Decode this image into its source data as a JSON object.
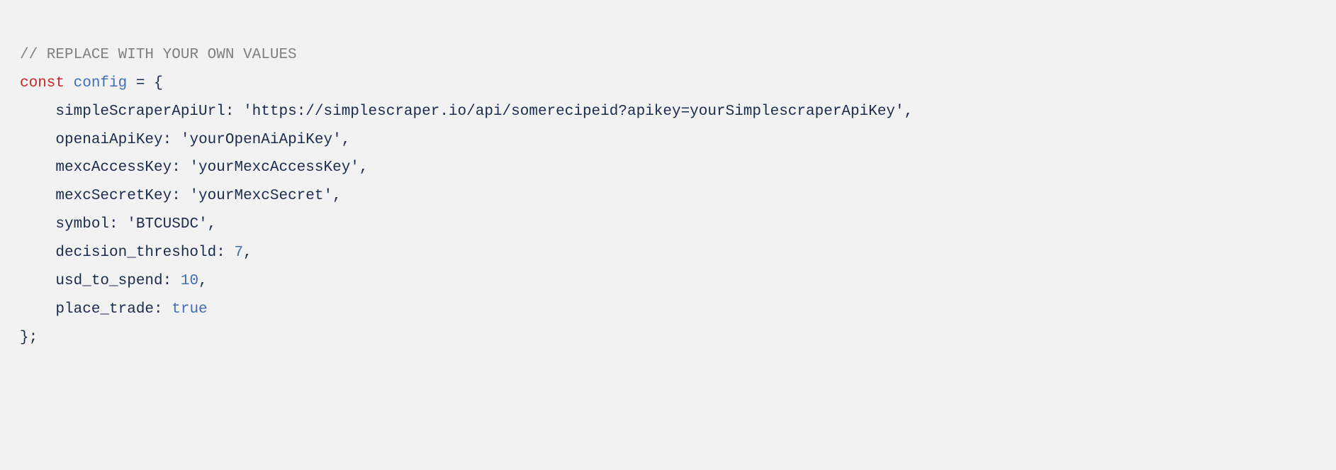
{
  "code": {
    "comment": "// REPLACE WITH YOUR OWN VALUES",
    "const_keyword": "const",
    "var_name": "config",
    "assign": " = ",
    "open_brace": "{",
    "close_brace": "};",
    "props": {
      "simpleScraperApiUrl": {
        "key": "simpleScraperApiUrl",
        "value": "'https://simplescraper.io/api/somerecipeid?apikey=yourSimplescraperApiKey'",
        "type": "string"
      },
      "openaiApiKey": {
        "key": "openaiApiKey",
        "value": "'yourOpenAiApiKey'",
        "type": "string"
      },
      "mexcAccessKey": {
        "key": "mexcAccessKey",
        "value": "'yourMexcAccessKey'",
        "type": "string"
      },
      "mexcSecretKey": {
        "key": "mexcSecretKey",
        "value": "'yourMexcSecret'",
        "type": "string"
      },
      "symbol": {
        "key": "symbol",
        "value": "'BTCUSDC'",
        "type": "string"
      },
      "decision_threshold": {
        "key": "decision_threshold",
        "value": "7",
        "type": "number"
      },
      "usd_to_spend": {
        "key": "usd_to_spend",
        "value": "10",
        "type": "number"
      },
      "place_trade": {
        "key": "place_trade",
        "value": "true",
        "type": "bool"
      }
    },
    "colon_sep": ": ",
    "comma": ","
  }
}
